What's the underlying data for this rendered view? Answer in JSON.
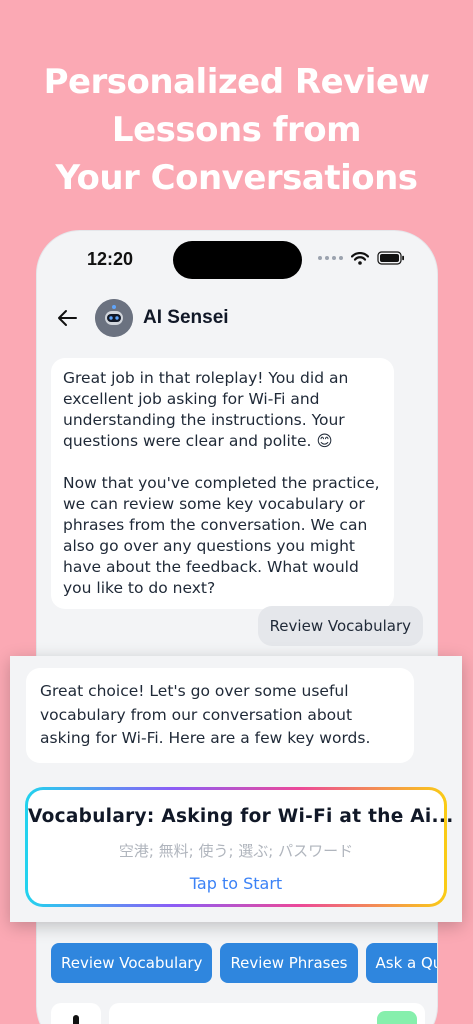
{
  "headline": [
    "Personalized Review",
    "Lessons from",
    "Your Conversations"
  ],
  "status": {
    "time": "12:20"
  },
  "chat": {
    "bot_name": "AI Sensei",
    "ai_message_1": {
      "p1": "Great job in that roleplay! You did an excellent job asking for Wi-Fi and understanding the instructions. Your questions were clear and polite. 😊",
      "p2": "Now that you've completed the practice, we can review some key vocabulary or phrases from the conversation. We can also go over any questions you might have about the feedback. What would you like to do next?"
    },
    "user_message": "Review Vocabulary",
    "ai_message_2": "Great choice! Let's go over some useful vocabulary from our conversation about asking for Wi-Fi. Here are a few key words."
  },
  "vocab_card": {
    "title": "Vocabulary: Asking for Wi-Fi at the Ai...",
    "words": "空港; 無料; 使う; 選ぶ; パスワード",
    "cta": "Tap to Start"
  },
  "quick_replies": [
    "Review Vocabulary",
    "Review Phrases",
    "Ask a Ques"
  ],
  "colors": {
    "background": "#fba9b4",
    "accent": "#2f86de",
    "link": "#3b82f6",
    "send": "#86efac"
  }
}
